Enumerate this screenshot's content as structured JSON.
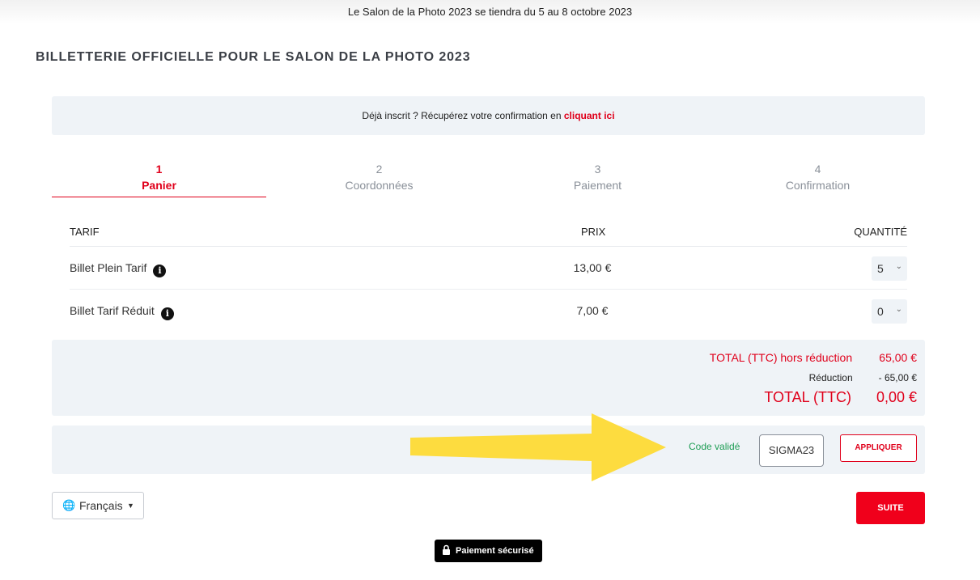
{
  "banner": {
    "text": "Le Salon de la Photo 2023 se tiendra du 5 au 8 octobre 2023"
  },
  "page": {
    "title": "BILLETTERIE OFFICIELLE POUR LE SALON DE LA PHOTO 2023"
  },
  "notice": {
    "text": "Déjà inscrit ? Récupérez votre confirmation en ",
    "link": "cliquant ici"
  },
  "steps": [
    {
      "num": "1",
      "label": "Panier",
      "active": true
    },
    {
      "num": "2",
      "label": "Coordonnées",
      "active": false
    },
    {
      "num": "3",
      "label": "Paiement",
      "active": false
    },
    {
      "num": "4",
      "label": "Confirmation",
      "active": false
    }
  ],
  "table": {
    "headers": {
      "tarif": "TARIF",
      "prix": "PRIX",
      "quantite": "QUANTITÉ"
    },
    "rows": [
      {
        "name": "Billet Plein Tarif",
        "price": "13,00 €",
        "qty": "5"
      },
      {
        "name": "Billet Tarif Réduit",
        "price": "7,00 €",
        "qty": "0"
      }
    ]
  },
  "totals": {
    "subtotal_label": "TOTAL (TTC) hors réduction",
    "subtotal_value": "65,00 €",
    "discount_label": "Réduction",
    "discount_value": "- 65,00 €",
    "total_label": "TOTAL (TTC)",
    "total_value": "0,00 €"
  },
  "promo": {
    "status": "Code validé",
    "code": "SIGMA23",
    "apply_label": "APPLIQUER"
  },
  "footer": {
    "language": "Français",
    "next_label": "SUITE",
    "secure_label": "Paiement sécurisé"
  },
  "colors": {
    "accent": "#e0001b",
    "panel": "#eff3f7",
    "success": "#1f9d55",
    "arrow": "#fddc3f"
  },
  "icons": {
    "info": "info-icon",
    "globe": "globe-icon",
    "lock": "lock-icon",
    "chevron": "chevron-down-icon",
    "arrow": "arrow-right-icon"
  }
}
